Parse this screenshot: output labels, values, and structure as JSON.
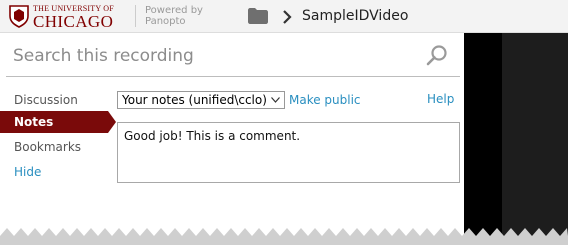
{
  "header": {
    "logo_line1": "THE UNIVERSITY OF",
    "logo_line2": "CHICAGO",
    "powered_line1": "Powered by",
    "powered_line2": "Panopto",
    "folder_icon": "folder-icon",
    "breadcrumb_separator_icon": "chevron-right-icon",
    "recording_title": "SampleIDVideo"
  },
  "search": {
    "placeholder": "Search this recording",
    "icon": "search-icon"
  },
  "sidebar": {
    "items": [
      {
        "label": "Discussion",
        "active": false
      },
      {
        "label": "Notes",
        "active": true
      },
      {
        "label": "Bookmarks",
        "active": false
      }
    ],
    "hide_label": "Hide"
  },
  "notes": {
    "selected_channel": "Your notes (unified\\cclo)",
    "make_public_label": "Make public",
    "help_label": "Help",
    "comment_text": "Good job! This is a comment."
  },
  "colors": {
    "brand_maroon": "#7a0a0a",
    "link_blue": "#2a8fc0",
    "header_bg": "#f3f3f3",
    "player_dark": "#1d1d1d"
  }
}
